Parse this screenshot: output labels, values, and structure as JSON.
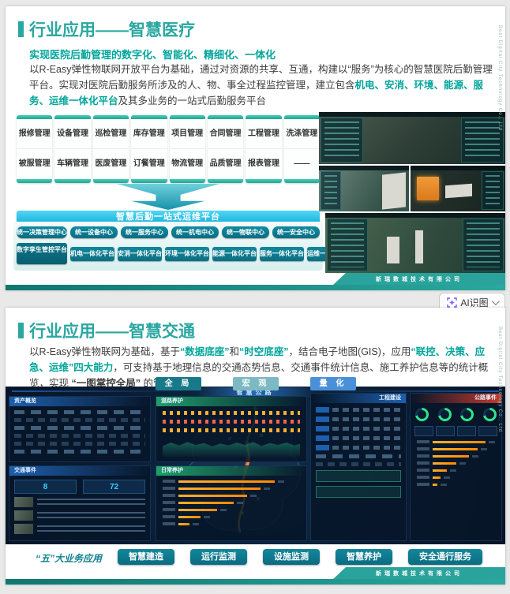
{
  "company": "新瑞数城技术有限公司",
  "watermark": "Best Digital City Technology Co., Ltd",
  "ai_button": {
    "label": "AI识图"
  },
  "slide1": {
    "title": "行业应用——智慧医疗",
    "subtitle": "实现医院后勤管理的数字化、智能化、精细化、一体化",
    "body": {
      "s1": "以R-Easy弹性物联网开放平台为基础，通过对资源的共享、互通，构建以“服务”为核心的智慧医院后勤管理平台。实现对医院后勤服务所涉及的人、物、事全过程监控管理，建立包含",
      "hl": "机电、安消、环境、能源、服务、运维一体化平台",
      "s2": "及其多业务的一站式后勤服务平台"
    },
    "grid": [
      {
        "top": "报修管理",
        "bottom": "被服管理"
      },
      {
        "top": "设备管理",
        "bottom": "车辆管理"
      },
      {
        "top": "巡检管理",
        "bottom": "医废管理"
      },
      {
        "top": "库存管理",
        "bottom": "订餐管理"
      },
      {
        "top": "项目管理",
        "bottom": "物流管理"
      },
      {
        "top": "合同管理",
        "bottom": "品质管理"
      },
      {
        "top": "工程管理",
        "bottom": "报表管理"
      },
      {
        "top": "洗涤管理",
        "bottom": "——"
      }
    ],
    "platform_bar": "智慧后勤一站式运维平台",
    "centers": [
      "统一决策管理中心",
      "统一设备中心",
      "统一服务中心",
      "统一机电中心",
      "统一物联中心",
      "统一安全中心"
    ],
    "platforms": [
      "数字孪生管控平台",
      "机电一体化平台",
      "安消一体化平台",
      "环境一体化平台",
      "能源一体化平台",
      "服务一体化平台",
      "运维一体化平台"
    ]
  },
  "slide2": {
    "title": "行业应用——智慧交通",
    "body": {
      "s1": "以R-Easy弹性物联网为基础，基于",
      "hl1": "“数据底座”",
      "mid": "和",
      "hl2": "“时空底座”",
      "s2": "，结合电子地图(GIS)，应用",
      "hl3": "“联控、决策、应急、运维”四大能力",
      "s3": "，可支持基于地理信息的交通态势信息、交通事件统计信息、施工养护信息等的统计概览，实现 ",
      "bold": "“一图掌控全局”",
      "s4": " 的管理要求."
    },
    "view_buttons": [
      "全 局",
      "宏 观",
      "量 化"
    ],
    "dashboard": {
      "title": "智慧公路",
      "panel_asset": "资产概览",
      "panel_road": "道路养护",
      "panel_traffic": "交通事件",
      "traffic_today": "8",
      "traffic_total": "72",
      "panel_daily": "日常养护",
      "panel_construction": "工程建设",
      "panel_event": "公路事件"
    },
    "apps_label": "“五”大业务应用",
    "apps": [
      "智慧建造",
      "运行监测",
      "设施监测",
      "智慧养护",
      "安全通行服务"
    ]
  }
}
